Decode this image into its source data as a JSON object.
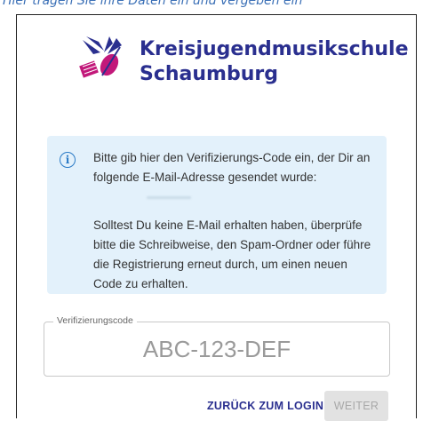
{
  "caption": "Hier tragen Sie ihre Daten ein und vergeben ein",
  "logo": {
    "line1": "Kreisjugendmusikschule",
    "line2": "Schaumburg",
    "brand_color": "#2a2f8f",
    "accent_color": "#c2187a"
  },
  "info": {
    "icon": "info-icon",
    "paragraph1": "Bitte gib hier den Verifizierungs-Code ein, der Dir an folgende E-Mail-Adresse gesendet wurde:",
    "paragraph2": "Solltest Du keine E-Mail erhalten haben, überprüfe bitte die Schreibweise, den Spam-Ordner oder führe die Registrierung erneut durch, um einen neuen Code zu erhalten.",
    "background": "#e3f1fb"
  },
  "verification": {
    "label": "Verifizierungscode",
    "placeholder": "ABC-123-DEF",
    "value": ""
  },
  "actions": {
    "back_label": "ZURÜCK ZUM LOGIN",
    "next_label": "WEITER"
  }
}
